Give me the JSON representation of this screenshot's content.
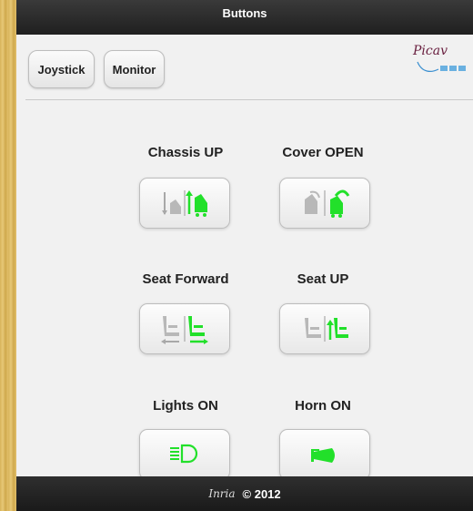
{
  "topbar": {
    "title": "Buttons"
  },
  "nav": {
    "joystick_label": "Joystick",
    "monitor_label": "Monitor"
  },
  "logo": {
    "text": "Picav"
  },
  "controls": [
    {
      "label": "Chassis UP",
      "icon": "chassis-up-icon"
    },
    {
      "label": "Cover OPEN",
      "icon": "cover-open-icon"
    },
    {
      "label": "Seat Forward",
      "icon": "seat-forward-icon"
    },
    {
      "label": "Seat UP",
      "icon": "seat-up-icon"
    },
    {
      "label": "Lights ON",
      "icon": "headlight-icon"
    },
    {
      "label": "Horn ON",
      "icon": "horn-icon"
    }
  ],
  "footer": {
    "brand": "Inria",
    "copyright": "© 2012"
  },
  "colors": {
    "active": "#22e02a",
    "inactive": "#a8a8a8"
  }
}
